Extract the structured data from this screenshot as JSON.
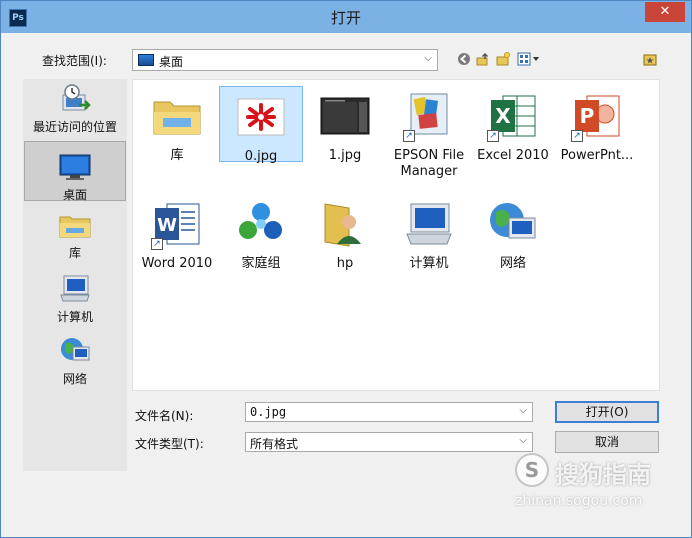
{
  "window": {
    "app_icon": "Ps",
    "title": "打开",
    "close_glyph": "✕"
  },
  "lookin": {
    "label": "查找范围(I):",
    "value": "桌面",
    "icons": [
      "back-icon",
      "up-folder-icon",
      "new-folder-icon",
      "view-menu-icon",
      "desktop-pane-icon"
    ]
  },
  "places": [
    {
      "label": "最近访问的位置",
      "icon": "recent-places-icon"
    },
    {
      "label": "桌面",
      "icon": "desktop-icon",
      "selected": true
    },
    {
      "label": "库",
      "icon": "libraries-icon"
    },
    {
      "label": "计算机",
      "icon": "computer-icon"
    },
    {
      "label": "网络",
      "icon": "network-icon"
    }
  ],
  "files": [
    {
      "name": "库",
      "icon": "libraries-icon"
    },
    {
      "name": "0.jpg",
      "icon": "image-red-flower-icon",
      "selected": true
    },
    {
      "name": "1.jpg",
      "icon": "image-screenshot-icon"
    },
    {
      "name": "EPSON File Manager",
      "icon": "epson-app-icon",
      "shortcut": true
    },
    {
      "name": "Excel 2010",
      "icon": "excel-icon",
      "shortcut": true
    },
    {
      "name": "PowerPnt...",
      "icon": "powerpoint-icon",
      "shortcut": true
    },
    {
      "name": "Word 2010",
      "icon": "word-icon",
      "shortcut": true
    },
    {
      "name": "家庭组",
      "icon": "homegroup-icon"
    },
    {
      "name": "hp",
      "icon": "user-folder-icon"
    },
    {
      "name": "计算机",
      "icon": "computer-icon"
    },
    {
      "name": "网络",
      "icon": "network-icon"
    }
  ],
  "filename": {
    "label": "文件名(N):",
    "value": "0.jpg"
  },
  "filetype": {
    "label": "文件类型(T):",
    "value": "所有格式"
  },
  "buttons": {
    "open": "打开(O)",
    "cancel": "取消"
  },
  "watermark": {
    "logo": "S",
    "text": "搜狗指南",
    "url": "zhinan.sogou.com"
  },
  "colors": {
    "title_bar": "#7cb1e6",
    "selection": "#cce8ff",
    "close": "#c9453a",
    "excel": "#1f7244",
    "word": "#2a5699",
    "powerpoint": "#d04a26"
  }
}
